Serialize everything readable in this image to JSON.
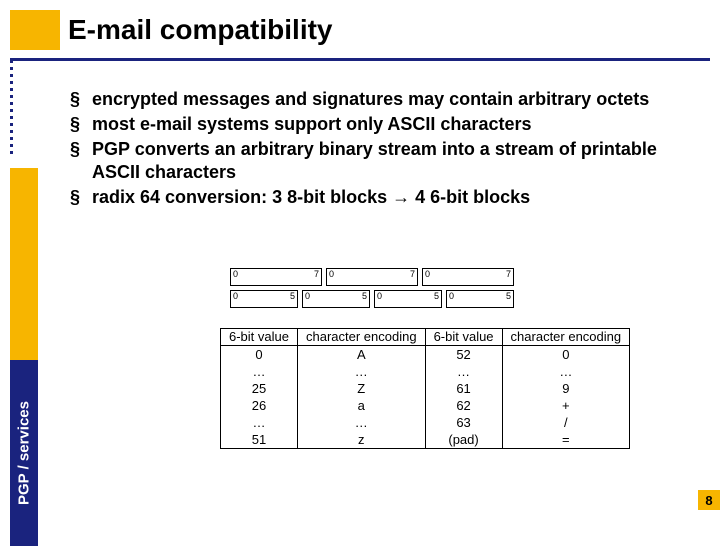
{
  "title": "E-mail compatibility",
  "sidebar_label": "PGP / services",
  "bullets": [
    "encrypted messages and signatures may contain arbitrary octets",
    "most e-mail systems support only ASCII characters",
    "PGP converts an arbitrary binary stream into a stream of printable ASCII characters",
    "radix 64 conversion: 3 8-bit blocks → 4 6-bit blocks"
  ],
  "diagram": {
    "row8": {
      "count": 3,
      "left": "0",
      "right": "7"
    },
    "row6": {
      "count": 4,
      "left": "0",
      "right": "5"
    }
  },
  "table": {
    "headers": [
      "6-bit value",
      "character encoding",
      "6-bit value",
      "character encoding"
    ],
    "rows": [
      [
        "0",
        "A",
        "52",
        "0"
      ],
      [
        "…",
        "…",
        "…",
        "…"
      ],
      [
        "25",
        "Z",
        "61",
        "9"
      ],
      [
        "26",
        "a",
        "62",
        "+"
      ],
      [
        "…",
        "…",
        "63",
        "/"
      ],
      [
        "51",
        "z",
        "(pad)",
        "="
      ]
    ]
  },
  "page_number": "8"
}
